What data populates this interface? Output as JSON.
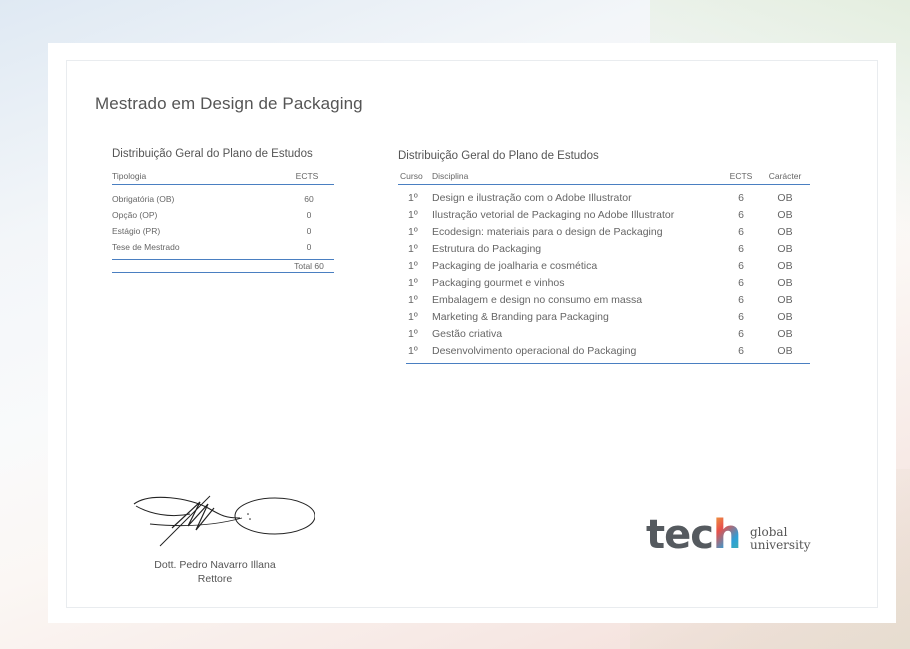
{
  "document": {
    "title": "Mestrado em Design de Packaging"
  },
  "summary": {
    "title": "Distribuição Geral do Plano de Estudos",
    "header": {
      "type": "Tipologia",
      "ects": "ECTS"
    },
    "rows": [
      {
        "type": "Obrigatória (OB)",
        "ects": "60"
      },
      {
        "type": "Opção (OP)",
        "ects": "0"
      },
      {
        "type": "Estágio (PR)",
        "ects": "0"
      },
      {
        "type": "Tese de Mestrado",
        "ects": "0"
      }
    ],
    "total": "Total 60"
  },
  "detail": {
    "title": "Distribuição Geral do Plano de Estudos",
    "header": {
      "curso": "Curso",
      "disciplina": "Disciplina",
      "ects": "ECTS",
      "caracter": "Carácter"
    },
    "rows": [
      {
        "curso": "1º",
        "disciplina": "Design e ilustração com o Adobe Illustrator",
        "ects": "6",
        "caracter": "OB"
      },
      {
        "curso": "1º",
        "disciplina": "Ilustração vetorial de Packaging no Adobe Illustrator",
        "ects": "6",
        "caracter": "OB"
      },
      {
        "curso": "1º",
        "disciplina": "Ecodesign: materiais para o design de Packaging",
        "ects": "6",
        "caracter": "OB"
      },
      {
        "curso": "1º",
        "disciplina": "Estrutura do Packaging",
        "ects": "6",
        "caracter": "OB"
      },
      {
        "curso": "1º",
        "disciplina": "Packaging de joalharia e cosmética",
        "ects": "6",
        "caracter": "OB"
      },
      {
        "curso": "1º",
        "disciplina": "Packaging gourmet e vinhos",
        "ects": "6",
        "caracter": "OB"
      },
      {
        "curso": "1º",
        "disciplina": "Embalagem e design no consumo em massa",
        "ects": "6",
        "caracter": "OB"
      },
      {
        "curso": "1º",
        "disciplina": "Marketing & Branding para Packaging",
        "ects": "6",
        "caracter": "OB"
      },
      {
        "curso": "1º",
        "disciplina": "Gestão criativa",
        "ects": "6",
        "caracter": "OB"
      },
      {
        "curso": "1º",
        "disciplina": "Desenvolvimento operacional do Packaging",
        "ects": "6",
        "caracter": "OB"
      }
    ]
  },
  "signature": {
    "name": "Dott. Pedro Navarro Illana",
    "role": "Rettore"
  },
  "logo": {
    "wordmark": "tech",
    "line1": "global",
    "line2": "university",
    "colors": [
      "#f0b43c",
      "#e8504a",
      "#2e9fd8",
      "#44b99a"
    ]
  }
}
